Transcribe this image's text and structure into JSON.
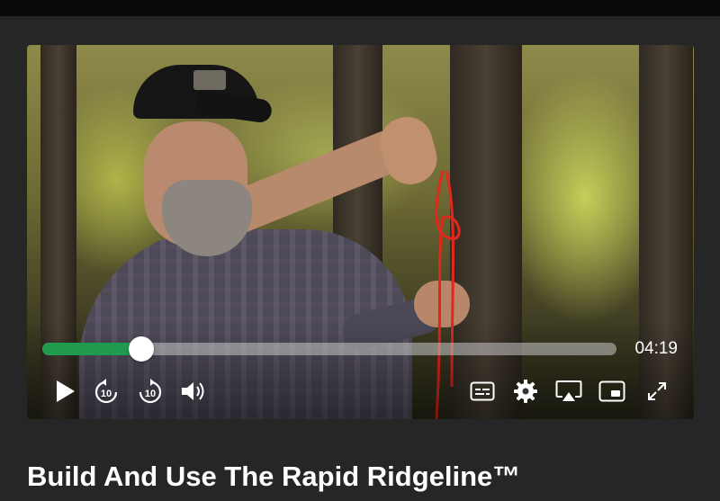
{
  "player": {
    "progress_fraction": 0.172,
    "duration": "04:19",
    "controls": [
      {
        "name": "play-icon"
      },
      {
        "name": "rewind-10-icon",
        "label": "10"
      },
      {
        "name": "forward-10-icon",
        "label": "10"
      },
      {
        "name": "volume-icon"
      },
      {
        "name": "captions-icon"
      },
      {
        "name": "settings-gear-icon"
      },
      {
        "name": "airplay-icon"
      },
      {
        "name": "picture-in-picture-icon"
      },
      {
        "name": "fullscreen-icon"
      }
    ],
    "accent_color": "#1f9a4f"
  },
  "video": {
    "title": "Build And Use The Rapid Ridgeline™"
  }
}
